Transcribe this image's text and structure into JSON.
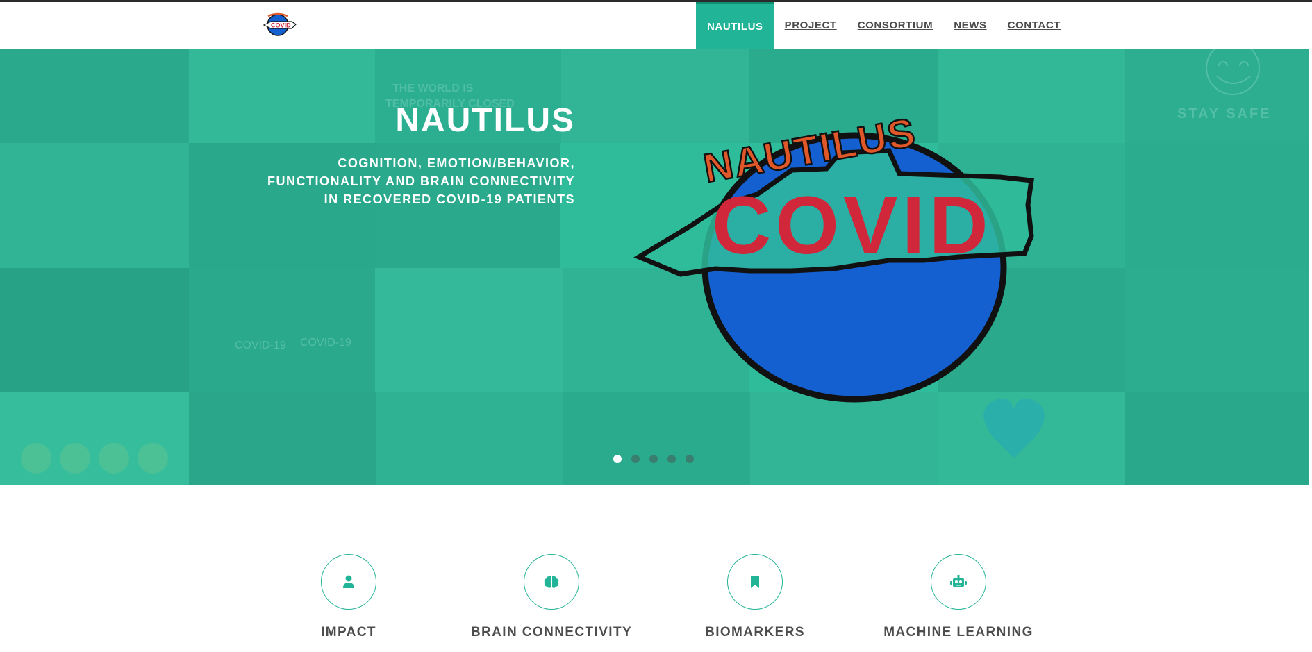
{
  "header": {
    "logo_alt": "Nautilus Covid logo",
    "nav": [
      {
        "label": "NAUTILUS",
        "active": true
      },
      {
        "label": "PROJECT",
        "active": false
      },
      {
        "label": "CONSORTIUM",
        "active": false
      },
      {
        "label": "NEWS",
        "active": false
      },
      {
        "label": "CONTACT",
        "active": false
      }
    ]
  },
  "hero": {
    "title": "NAUTILUS",
    "subtitle_lines": [
      "COGNITION, EMOTION/BEHAVIOR,",
      "FUNCTIONALITY AND BRAIN CONNECTIVITY",
      "IN RECOVERED COVID-19 PATIENTS"
    ],
    "art_top_text": "NAUTILUS",
    "art_center_text": "COVID",
    "slide_count": 5,
    "active_slide": 1
  },
  "features": [
    {
      "label": "IMPACT",
      "icon": "person-icon"
    },
    {
      "label": "BRAIN CONNECTIVITY",
      "icon": "brain-icon"
    },
    {
      "label": "BIOMARKERS",
      "icon": "bookmark-icon"
    },
    {
      "label": "MACHINE LEARNING",
      "icon": "robot-icon"
    }
  ],
  "colors": {
    "accent": "#22b496",
    "hero_bg": "#2fbc9b",
    "text_dark": "#4d4d4d",
    "covid_red": "#d0283a",
    "globe_blue": "#1560d0"
  }
}
